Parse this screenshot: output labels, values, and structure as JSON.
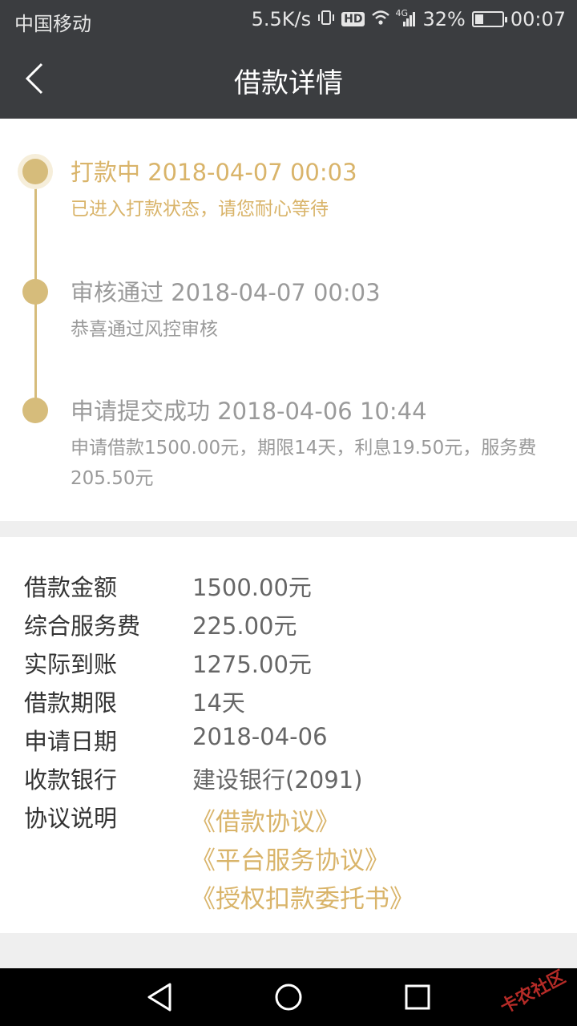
{
  "status_bar": {
    "carrier": "中国移动",
    "speed": "5.5K/s",
    "hd": "HD",
    "network": "4G",
    "battery": "32%",
    "battery_level": 0.32,
    "time": "00:07"
  },
  "header": {
    "title": "借款详情"
  },
  "timeline": [
    {
      "title": "打款中 2018-04-07 00:03",
      "desc": "已进入打款状态，请您耐心等待"
    },
    {
      "title": "审核通过 2018-04-07 00:03",
      "desc": "恭喜通过风控审核"
    },
    {
      "title": "申请提交成功 2018-04-06 10:44",
      "desc": "申请借款1500.00元，期限14天，利息19.50元，服务费205.50元"
    }
  ],
  "details": [
    {
      "label": "借款金额",
      "value": "1500.00元"
    },
    {
      "label": "综合服务费",
      "value": "225.00元"
    },
    {
      "label": "实际到账",
      "value": "1275.00元"
    },
    {
      "label": "借款期限",
      "value": "14天"
    },
    {
      "label": "申请日期",
      "value": "2018-04-06"
    },
    {
      "label": "收款银行",
      "value": "建设银行(2091)"
    },
    {
      "label": "协议说明",
      "value": ""
    }
  ],
  "agreements": [
    "《借款协议》",
    "《平台服务协议》",
    "《授权扣款委托书》"
  ],
  "watermark": "卡农社区",
  "colors": {
    "accent": "#d9b46a",
    "header_bg": "#3b3d40"
  }
}
